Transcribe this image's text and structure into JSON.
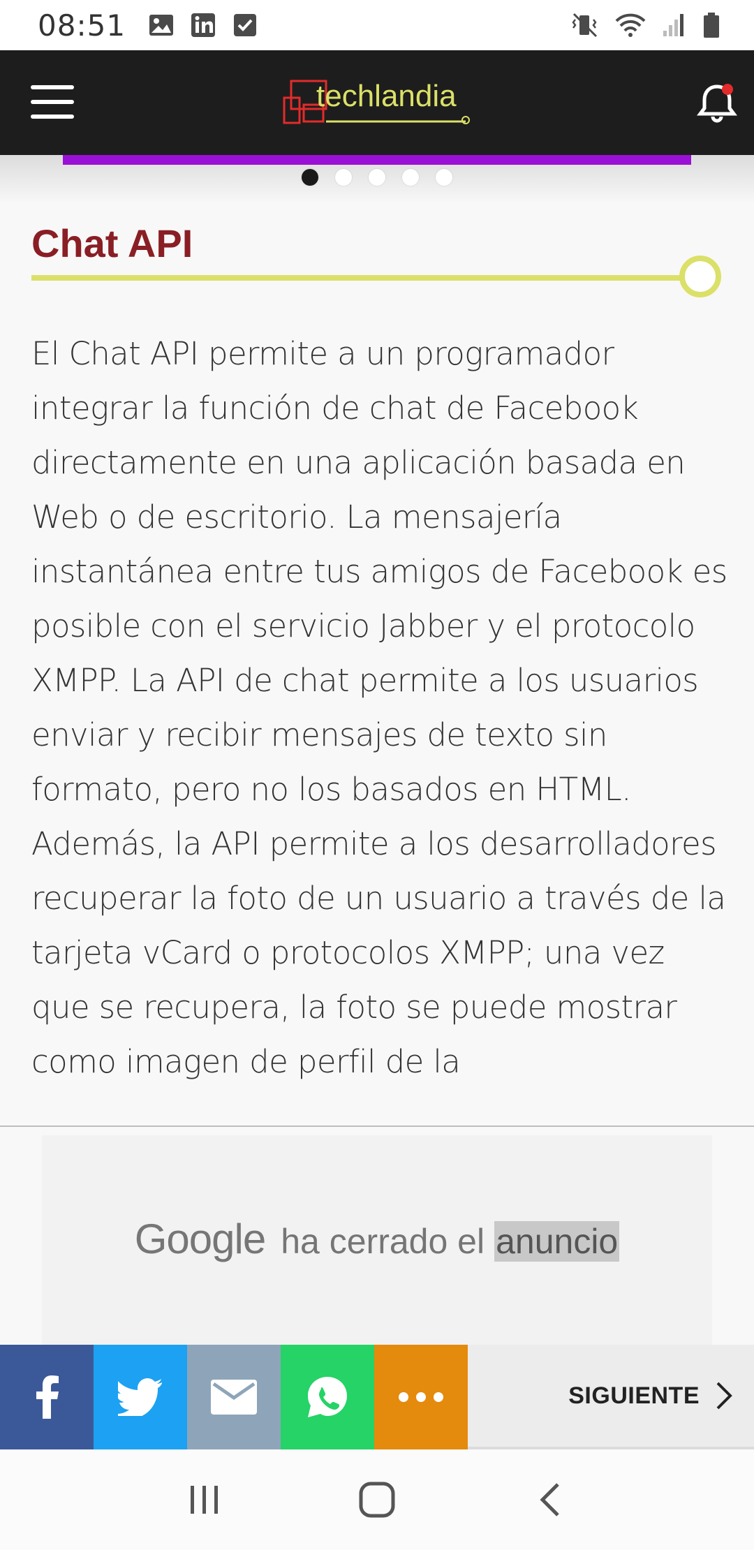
{
  "status_bar": {
    "time": "08:51",
    "left_icons": [
      "image-icon",
      "linkedin-icon",
      "check-square-icon"
    ],
    "right_icons": [
      "vibrate-icon",
      "wifi-icon",
      "signal-icon",
      "battery-icon"
    ]
  },
  "header": {
    "logo_text": "techlandia",
    "menu_icon": "hamburger-icon",
    "notification_icon": "bell-icon",
    "brand_color": "#dbe068",
    "logo_accent": "#e32b2b"
  },
  "carousel": {
    "accent_color": "#9b10d6",
    "dots": 5,
    "active_dot": 1
  },
  "article": {
    "title": "Chat API",
    "title_color": "#8a1e25",
    "body": "El Chat API permite a un programador integrar la función de chat de Facebook directamente en una aplicación basada en Web o de escritorio. La mensajería instantánea entre tus amigos de Facebook es posible con el servicio Jabber y el protocolo XMPP. La API de chat permite a los usuarios enviar y recibir mensajes de texto sin formato, pero no los basados en HTML. Además, la API permite a los desarrolladores recuperar la foto de un usuario a través de la tarjeta vCard o protocolos XMPP; una vez que se recupera, la foto se puede mostrar como imagen de perfil de la"
  },
  "ad": {
    "brand": "Google",
    "text": "ha cerrado el",
    "highlight": "anuncio"
  },
  "share_bar": {
    "buttons": [
      {
        "name": "facebook",
        "icon": "facebook-icon",
        "color": "#3b5998"
      },
      {
        "name": "twitter",
        "icon": "twitter-icon",
        "color": "#1da1f2"
      },
      {
        "name": "email",
        "icon": "mail-icon",
        "color": "#8ea5b9"
      },
      {
        "name": "whatsapp",
        "icon": "whatsapp-icon",
        "color": "#25d366"
      },
      {
        "name": "more",
        "icon": "more-icon",
        "color": "#e48a0c"
      }
    ],
    "next_label": "SIGUIENTE"
  },
  "nav_bar": {
    "buttons": [
      "recents-icon",
      "home-icon",
      "back-icon"
    ]
  }
}
